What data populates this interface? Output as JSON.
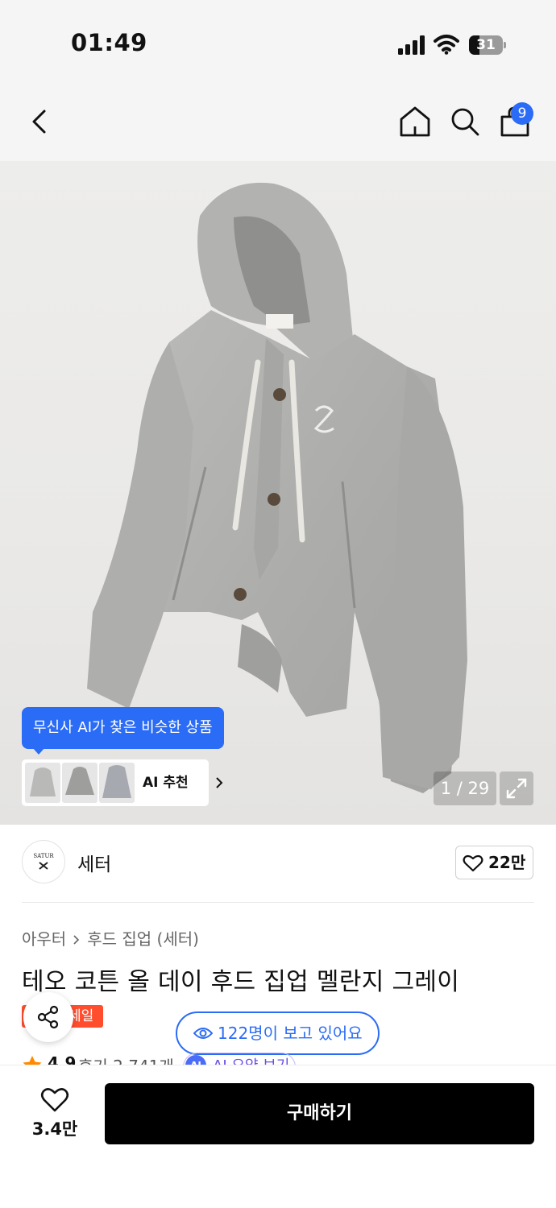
{
  "status_bar": {
    "time": "01:49",
    "battery": "31",
    "battery_level_percent": 31
  },
  "nav": {
    "back_icon": "chevron-left-icon",
    "home_icon": "home-icon",
    "search_icon": "search-icon",
    "cart_icon": "shopping-bag-icon",
    "cart_badge": "9"
  },
  "gallery": {
    "ai_tooltip": "무신사 AI가 찾은 비슷한 상품",
    "ai_reco_label": "AI 추천",
    "counter": "1 / 29",
    "expand_icon": "expand-icon"
  },
  "brand": {
    "logo_text": "SATUR",
    "name": "세터",
    "likes": "22만"
  },
  "product": {
    "breadcrumb": [
      "아우터",
      "후드 집업 (세터)"
    ],
    "title": "테오 코튼 올 데이 후드 집업 멜란지 그레이",
    "sale_label": "세일",
    "viewers": "122명이 보고 있어요",
    "rating": "4.9",
    "reviews": "후기 2,741개",
    "ai_summary_badge": "AI",
    "ai_summary_label": "AI 요약 보기"
  },
  "bottom": {
    "wish_count": "3.4만",
    "buy_label": "구매하기"
  },
  "colors": {
    "accent": "#2b6cf6",
    "sale": "#ff4d2e",
    "buy_button": "#000000",
    "star": "#ff8a00"
  }
}
